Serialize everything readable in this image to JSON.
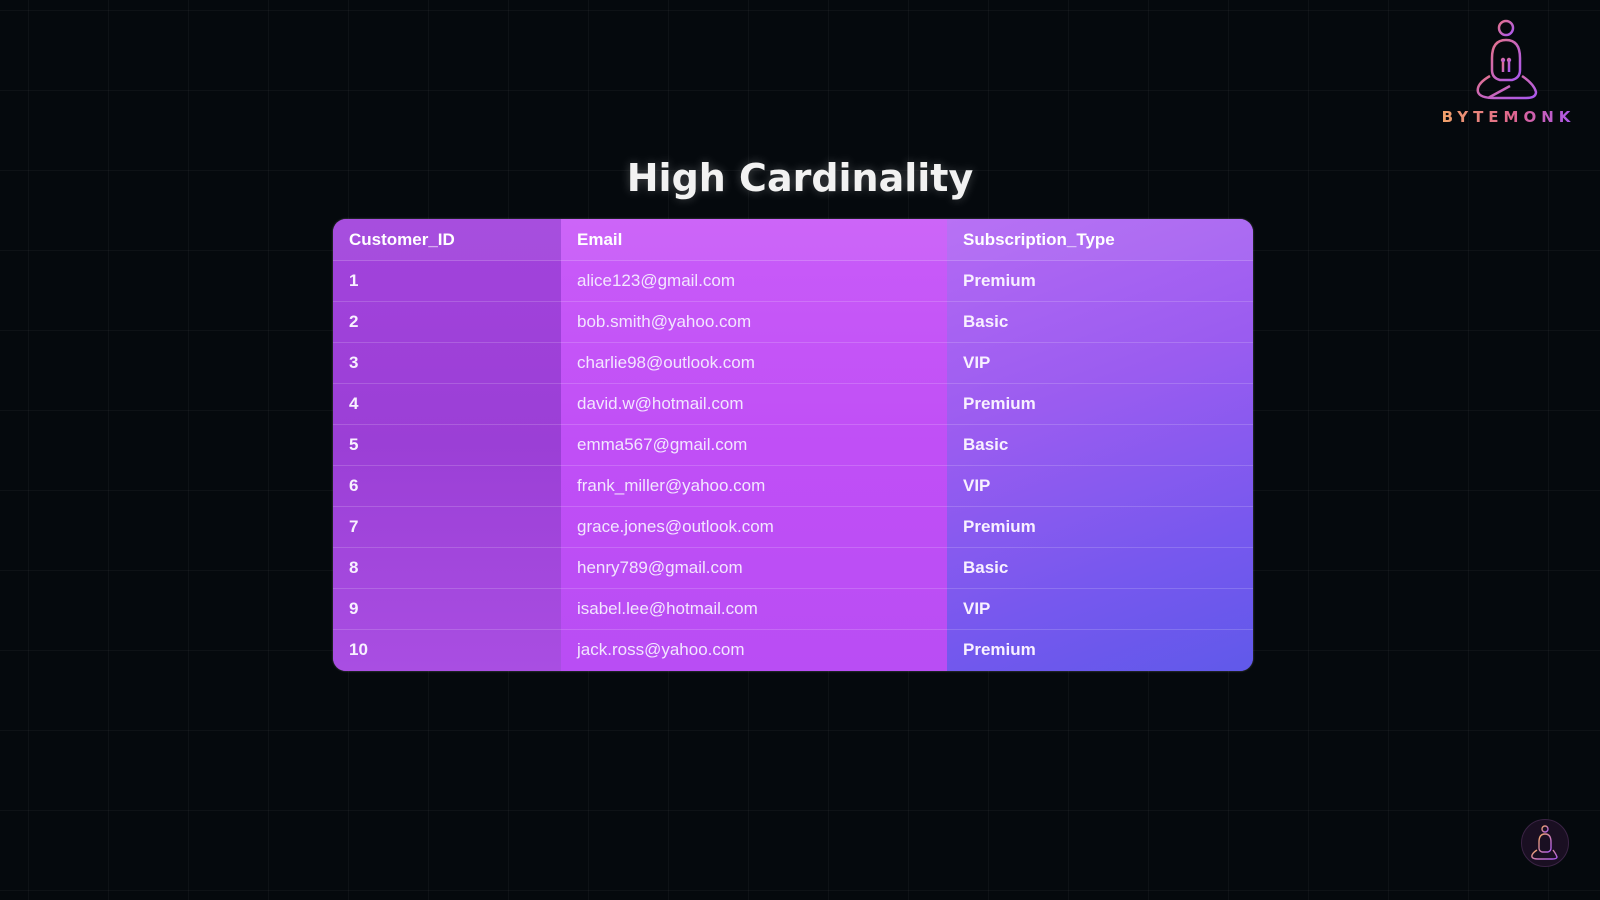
{
  "brand": {
    "name": "BYTEMONK"
  },
  "title": "High Cardinality",
  "table": {
    "headers": [
      "Customer_ID",
      "Email",
      "Subscription_Type"
    ],
    "rows": [
      [
        "1",
        "alice123@gmail.com",
        "Premium"
      ],
      [
        "2",
        "bob.smith@yahoo.com",
        "Basic"
      ],
      [
        "3",
        "charlie98@outlook.com",
        "VIP"
      ],
      [
        "4",
        "david.w@hotmail.com",
        "Premium"
      ],
      [
        "5",
        "emma567@gmail.com",
        "Basic"
      ],
      [
        "6",
        "frank_miller@yahoo.com",
        "VIP"
      ],
      [
        "7",
        "grace.jones@outlook.com",
        "Premium"
      ],
      [
        "8",
        "henry789@gmail.com",
        "Basic"
      ],
      [
        "9",
        "isabel.lee@hotmail.com",
        "VIP"
      ],
      [
        "10",
        "jack.ross@yahoo.com",
        "Premium"
      ]
    ]
  },
  "icons": {
    "logo": "monk-logo-icon",
    "corner": "monk-avatar-icon"
  },
  "colors": {
    "background": "#05090d",
    "table_gradient_start": "#b84ae6",
    "table_gradient_end": "#6059ea",
    "brand_gradient_start": "#f2a766",
    "brand_gradient_end": "#a957f0"
  }
}
